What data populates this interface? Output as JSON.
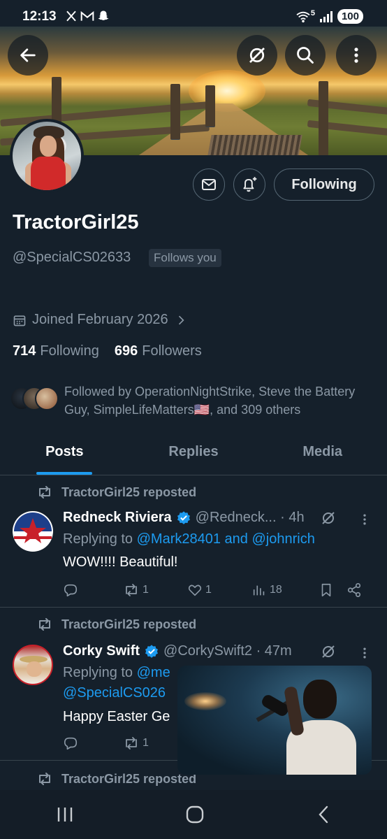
{
  "status_bar": {
    "time": "12:13",
    "network": "5",
    "battery": "100"
  },
  "profile": {
    "display_name": "TractorGirl25",
    "handle": "@SpecialCS02633",
    "follows_you": "Follows you",
    "joined": "Joined February 2026",
    "following_count": "714",
    "following_label": "Following",
    "followers_count": "696",
    "followers_label": "Followers",
    "followed_by": "Followed by OperationNightStrike, Steve the Battery Guy, SimpleLifeMatters🇺🇸, and 309 others",
    "following_button": "Following"
  },
  "tabs": [
    {
      "label": "Posts",
      "active": true
    },
    {
      "label": "Replies",
      "active": false
    },
    {
      "label": "Media",
      "active": false
    }
  ],
  "posts": [
    {
      "repost_label": "TractorGirl25 reposted",
      "name": "Redneck Riviera",
      "handle_time": "@Redneck... · 4h",
      "reply_prefix": "Replying to ",
      "reply_targets": "@Mark28401 and @johnrich",
      "text": "WOW!!!! Beautiful!",
      "reposts": "1",
      "likes": "1",
      "views": "18"
    },
    {
      "repost_label": "TractorGirl25 reposted",
      "name": "Corky Swift",
      "handle_time": "@CorkySwift2 · 47m",
      "reply_prefix": "Replying to ",
      "reply_line1": "@me",
      "reply_line2": "@SpecialCS026",
      "text": "Happy Easter Ge",
      "reposts": "1"
    },
    {
      "repost_label": "TractorGirl25 reposted"
    }
  ],
  "colors": {
    "background": "#15202b",
    "accent": "#1d9bf0",
    "muted": "#8b98a5",
    "divider": "#38444d"
  }
}
